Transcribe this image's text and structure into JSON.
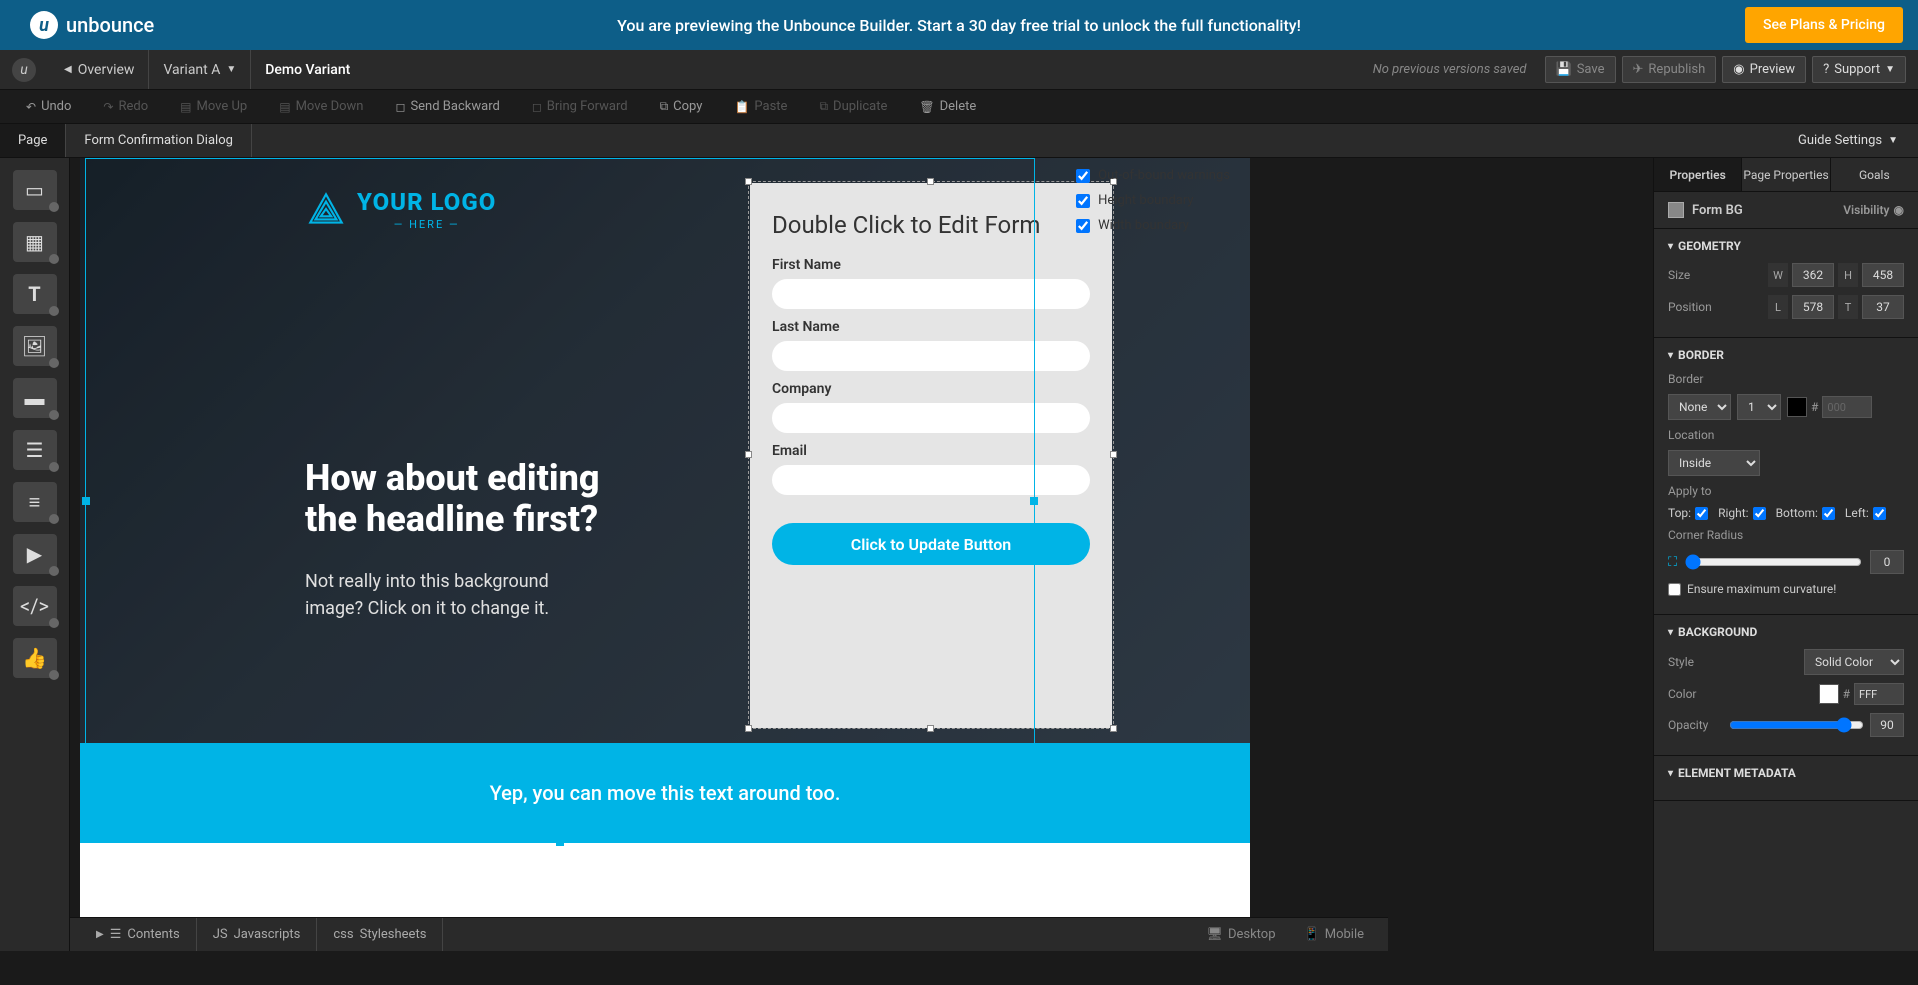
{
  "banner": {
    "brand": "unbounce",
    "message": "You are previewing the Unbounce Builder. Start a 30 day free trial to unlock the full functionality!",
    "cta": "See Plans & Pricing"
  },
  "header": {
    "overview": "Overview",
    "variant": "Variant A",
    "page_name": "Demo Variant",
    "version_status": "No previous versions saved",
    "save": "Save",
    "republish": "Republish",
    "preview": "Preview",
    "support": "Support"
  },
  "toolbar": {
    "undo": "Undo",
    "redo": "Redo",
    "move_up": "Move Up",
    "move_down": "Move Down",
    "send_backward": "Send Backward",
    "bring_forward": "Bring Forward",
    "copy": "Copy",
    "paste": "Paste",
    "duplicate": "Duplicate",
    "delete": "Delete"
  },
  "tabs": {
    "page": "Page",
    "dialog": "Form Confirmation Dialog",
    "guide_settings": "Guide Settings"
  },
  "guides": {
    "out_of_bound": "Out-of-bound warnings",
    "height_boundary": "Height boundary",
    "width_boundary": "Width boundary"
  },
  "canvas": {
    "logo_main": "YOUR LOGO",
    "logo_sub": "HERE",
    "headline_l1": "How about editing",
    "headline_l2": "the headline first?",
    "subline_l1": "Not really into this background",
    "subline_l2": "image? Click on it to change it.",
    "form_title": "Double Click to Edit Form",
    "first_name": "First Name",
    "last_name": "Last Name",
    "company": "Company",
    "email": "Email",
    "button": "Click to Update Button",
    "strip_text": "Yep, you can move this text around too."
  },
  "props": {
    "tab_properties": "Properties",
    "tab_page_properties": "Page Properties",
    "tab_goals": "Goals",
    "element_name": "Form BG",
    "visibility": "Visibility",
    "geometry": {
      "title": "GEOMETRY",
      "size": "Size",
      "w": "362",
      "h": "458",
      "position": "Position",
      "l": "578",
      "t": "37"
    },
    "border": {
      "title": "BORDER",
      "label": "Border",
      "style": "None",
      "width": "1",
      "hex": "000",
      "location_label": "Location",
      "location": "Inside",
      "apply_to": "Apply to",
      "top": "Top:",
      "right": "Right:",
      "bottom": "Bottom:",
      "left": "Left:",
      "corner_radius": "Corner Radius",
      "radius_val": "0",
      "ensure_max": "Ensure maximum curvature!"
    },
    "background": {
      "title": "BACKGROUND",
      "style_label": "Style",
      "style": "Solid Color",
      "color_label": "Color",
      "color_hex": "FFF",
      "opacity_label": "Opacity",
      "opacity": "90"
    },
    "metadata": {
      "title": "ELEMENT METADATA"
    }
  },
  "bottom": {
    "contents": "Contents",
    "javascripts": "Javascripts",
    "stylesheets": "Stylesheets",
    "desktop": "Desktop",
    "mobile": "Mobile"
  }
}
